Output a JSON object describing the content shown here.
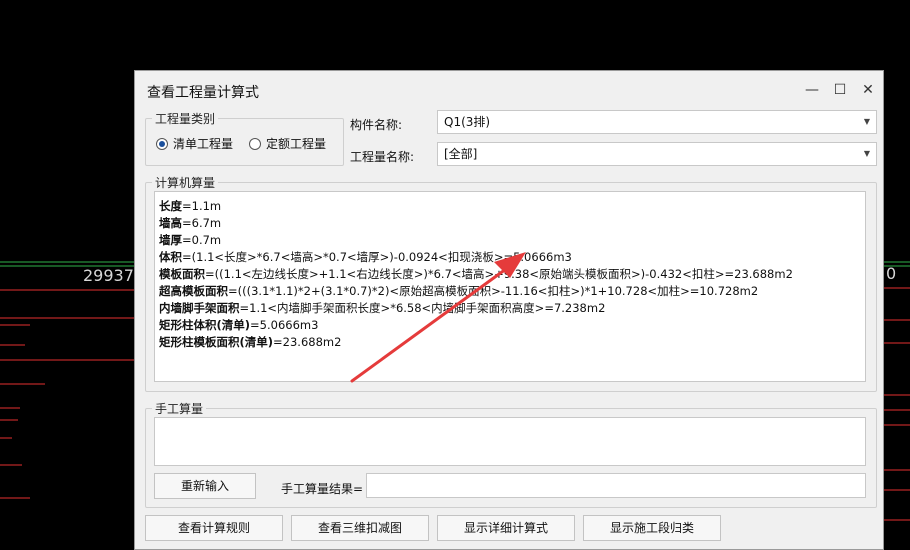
{
  "background": {
    "left_number": "29937",
    "right_number": "0"
  },
  "dialog": {
    "title": "查看工程量计算式",
    "window_buttons": {
      "minimize": "—",
      "maximize": "☐",
      "close": "✕"
    },
    "quantity_type": {
      "legend": "工程量类别",
      "options": [
        {
          "label": "清单工程量",
          "selected": true
        },
        {
          "label": "定额工程量",
          "selected": false
        }
      ]
    },
    "component_name": {
      "label": "构件名称:",
      "value": "Q1(3排)"
    },
    "quantity_name": {
      "label": "工程量名称:",
      "value": "[全部]"
    },
    "computer_calc": {
      "legend": "计算机算量",
      "lines": [
        {
          "name": "长度",
          "formula": "=1.1m"
        },
        {
          "name": "墙高",
          "formula": "=6.7m"
        },
        {
          "name": "墙厚",
          "formula": "=0.7m"
        },
        {
          "name": "体积",
          "formula": "=(1.1<长度>*6.7<墙高>*0.7<墙厚>)-0.0924<扣现浇板>=5.0666m3"
        },
        {
          "name": "模板面积",
          "formula": "=((1.1<左边线长度>+1.1<右边线长度>)*6.7<墙高>+9.38<原始端头模板面积>)-0.432<扣柱>=23.688m2"
        },
        {
          "name": "超高模板面积",
          "formula": "=(((3.1*1.1)*2+(3.1*0.7)*2)<原始超高模板面积>-11.16<扣柱>)*1+10.728<加柱>=10.728m2"
        },
        {
          "name": "内墙脚手架面积",
          "formula": "=1.1<内墙脚手架面积长度>*6.58<内墙脚手架面积高度>=7.238m2"
        },
        {
          "name": "矩形柱体积(清单)",
          "formula": "=5.0666m3"
        },
        {
          "name": "矩形柱模板面积(清单)",
          "formula": "=23.688m2"
        }
      ]
    },
    "manual_calc": {
      "legend": "手工算量",
      "reenter_label": "重新输入",
      "result_label": "手工算量结果=",
      "result_value": ""
    },
    "bottom_buttons": [
      "查看计算规则",
      "查看三维扣减图",
      "显示详细计算式",
      "显示施工段归类"
    ]
  },
  "colors": {
    "annotation_arrow": "#e53b3b",
    "cad_red": "#e53030",
    "cad_green": "#2fb24a"
  }
}
